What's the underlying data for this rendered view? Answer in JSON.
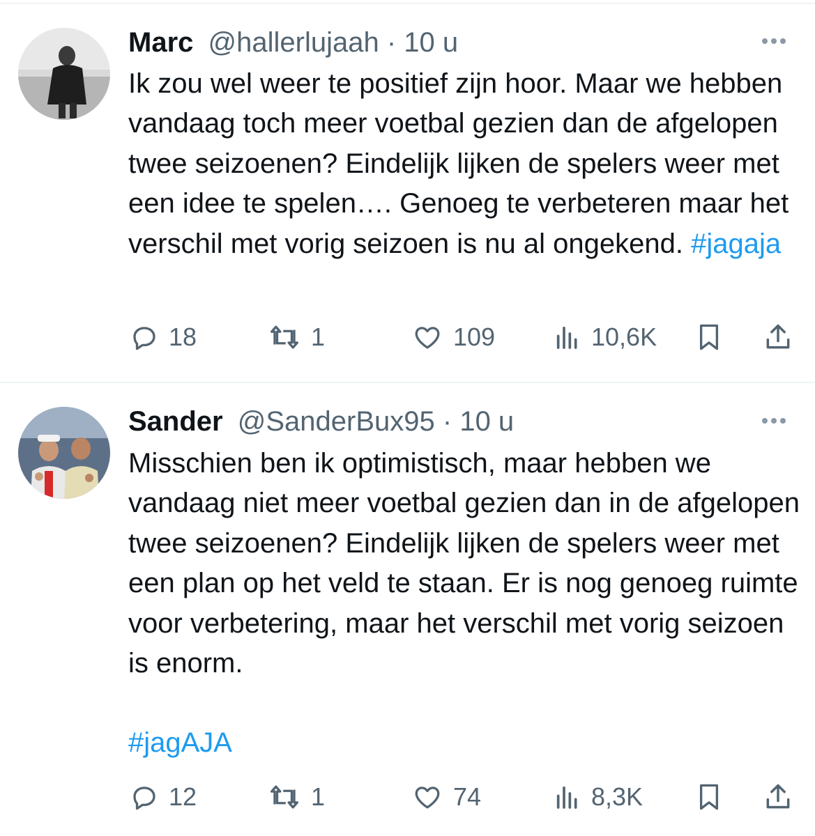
{
  "tweets": [
    {
      "author_name": "Marc",
      "handle": "@hallerlujaah",
      "separator": "·",
      "time": "10 u",
      "text": "Ik zou wel weer te positief zijn hoor. Maar we hebben vandaag toch meer voetbal gezien dan de afgelopen twee seizoenen? Eindelijk lijken de spelers weer met een idee te spelen…. Genoeg te verbeteren maar het verschil met vorig seizoen is nu al ongekend.",
      "hashtag": "#jagaja",
      "replies": "18",
      "retweets": "1",
      "likes": "109",
      "views": "10,6K"
    },
    {
      "author_name": "Sander",
      "handle": "@SanderBux95",
      "separator": "·",
      "time": "10 u",
      "text": "Misschien ben ik optimistisch, maar hebben we vandaag niet meer voetbal gezien dan in de afgelopen twee seizoenen? Eindelijk lijken de spelers weer met een plan op het veld te staan. Er is nog genoeg ruimte voor verbetering, maar het verschil met vorig seizoen is enorm.",
      "hashtag": "#jagAJA",
      "replies": "12",
      "retweets": "1",
      "likes": "74",
      "views": "8,3K"
    }
  ],
  "icons": {
    "reply": "reply-icon",
    "retweet": "retweet-icon",
    "like": "heart-icon",
    "views": "views-icon",
    "bookmark": "bookmark-icon",
    "share": "share-icon",
    "more": "more-icon"
  },
  "colors": {
    "text": "#0f1419",
    "secondary": "#536471",
    "link": "#1d9bf0",
    "divider": "#eff3f4"
  }
}
